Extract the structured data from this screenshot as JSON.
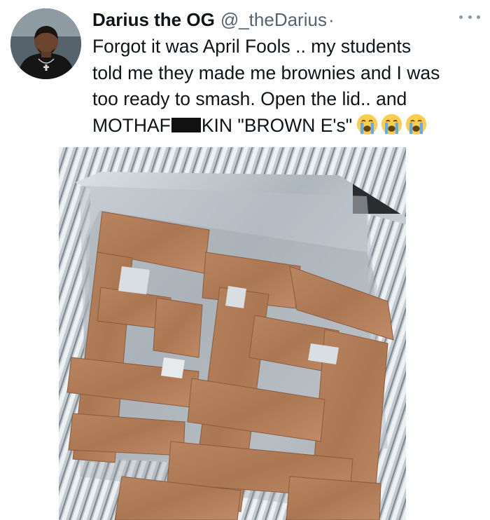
{
  "tweet": {
    "display_name": "Darius the OG",
    "handle": "@_theDarius",
    "separator": "·",
    "lines": [
      "Forgot it was April Fools .. my students",
      "told me they made me brownies and I was",
      "too ready to smash. Open the lid.. and"
    ],
    "last_line_pre": "MOTHAF",
    "last_line_post": "KIN \"BROWN E's\"",
    "emoji": [
      "loudly-crying-face",
      "loudly-crying-face",
      "loudly-crying-face"
    ]
  },
  "icons": {
    "avatar": "user-avatar",
    "more": "more-options-icon",
    "emoji": "loudly-crying-face-emoji"
  },
  "colors": {
    "text": "#0f1419",
    "secondary": "#536471",
    "cardboard": "#b07a55",
    "foil": "#c9d0d6"
  }
}
